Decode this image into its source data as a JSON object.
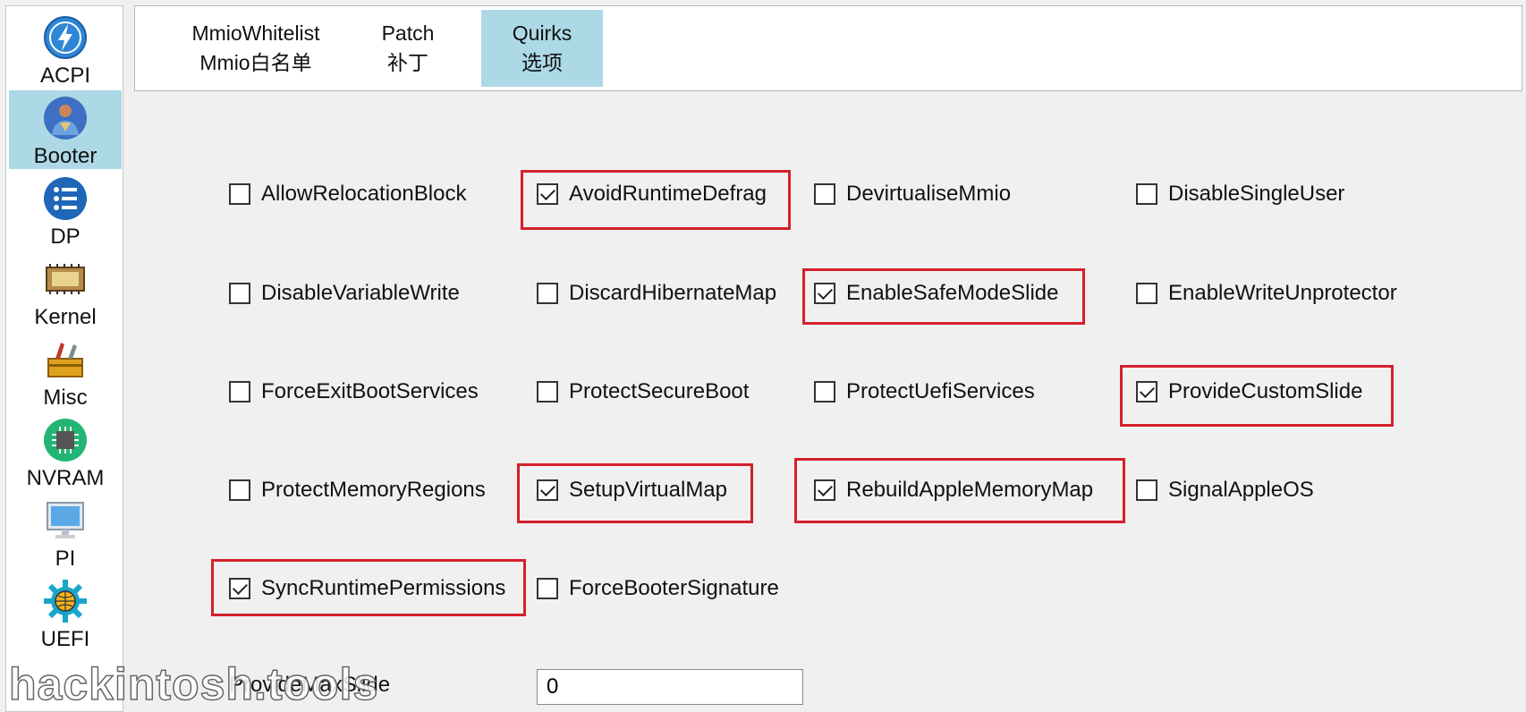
{
  "sidebar": {
    "items": [
      {
        "label": "ACPI",
        "icon": "bolt-icon"
      },
      {
        "label": "Booter",
        "icon": "avatar-icon"
      },
      {
        "label": "DP",
        "icon": "list-icon"
      },
      {
        "label": "Kernel",
        "icon": "chip-icon"
      },
      {
        "label": "Misc",
        "icon": "toolbox-icon"
      },
      {
        "label": "NVRAM",
        "icon": "cpu-icon"
      },
      {
        "label": "PI",
        "icon": "monitor-icon"
      },
      {
        "label": "UEFI",
        "icon": "gear-globe-icon"
      }
    ],
    "active": "Booter"
  },
  "tabs": [
    {
      "line1": "MmioWhitelist",
      "line2": "Mmio白名单"
    },
    {
      "line1": "Patch",
      "line2": "补丁"
    },
    {
      "line1": "Quirks",
      "line2": "选项"
    }
  ],
  "active_tab": "Quirks",
  "quirks": [
    {
      "label": "AllowRelocationBlock",
      "checked": false
    },
    {
      "label": "AvoidRuntimeDefrag",
      "checked": true
    },
    {
      "label": "DevirtualiseMmio",
      "checked": false
    },
    {
      "label": "DisableSingleUser",
      "checked": false
    },
    {
      "label": "DisableVariableWrite",
      "checked": false
    },
    {
      "label": "DiscardHibernateMap",
      "checked": false
    },
    {
      "label": "EnableSafeModeSlide",
      "checked": true
    },
    {
      "label": "EnableWriteUnprotector",
      "checked": false
    },
    {
      "label": "ForceExitBootServices",
      "checked": false
    },
    {
      "label": "ProtectSecureBoot",
      "checked": false
    },
    {
      "label": "ProtectUefiServices",
      "checked": false
    },
    {
      "label": "ProvideCustomSlide",
      "checked": true
    },
    {
      "label": "ProtectMemoryRegions",
      "checked": false
    },
    {
      "label": "SetupVirtualMap",
      "checked": true
    },
    {
      "label": "RebuildAppleMemoryMap",
      "checked": true
    },
    {
      "label": "SignalAppleOS",
      "checked": false
    },
    {
      "label": "SyncRuntimePermissions",
      "checked": true
    },
    {
      "label": "ForceBooterSignature",
      "checked": false
    }
  ],
  "provide_max_slide": {
    "label": "ProvideMaxSlide",
    "value": "0"
  },
  "watermark": "hackintosh.tools",
  "colors": {
    "accent": "#add8e6",
    "highlight": "#d4202a"
  }
}
